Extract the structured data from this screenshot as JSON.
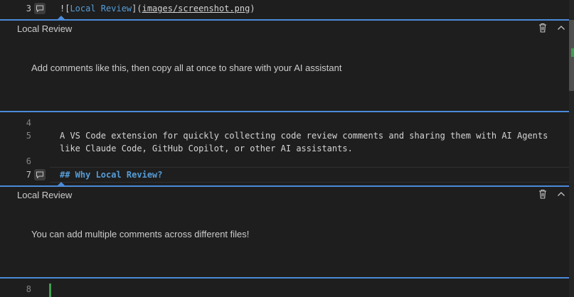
{
  "editor": {
    "lines": [
      {
        "number": "3",
        "parts": [
          {
            "text": "![",
            "style": "plain"
          },
          {
            "text": "Local Review",
            "style": "link"
          },
          {
            "text": "](",
            "style": "plain"
          },
          {
            "text": "images/screenshot.png",
            "style": "url"
          },
          {
            "text": ")",
            "style": "plain"
          }
        ]
      },
      {
        "number": "4",
        "text": ""
      },
      {
        "number": "5",
        "text": "A VS Code extension for quickly collecting code review comments and sharing them with AI Agents"
      },
      {
        "number": "",
        "text": "like Claude Code, GitHub Copilot, or other AI assistants."
      },
      {
        "number": "6",
        "text": ""
      },
      {
        "number": "7",
        "text": "## Why Local Review?"
      },
      {
        "number": "8",
        "text": ""
      }
    ]
  },
  "comments": [
    {
      "title": "Local Review",
      "body": "Add comments like this, then copy all at once to share with your AI assistant"
    },
    {
      "title": "Local Review",
      "body": "You can add multiple comments across different files!"
    }
  ],
  "colors": {
    "accent": "#4b8bd9",
    "modified_gutter": "#3e9e4f",
    "background": "#1e1e1e"
  },
  "icons": {
    "comment": "comment-icon",
    "delete": "trash-icon",
    "collapse": "chevron-up-icon"
  }
}
